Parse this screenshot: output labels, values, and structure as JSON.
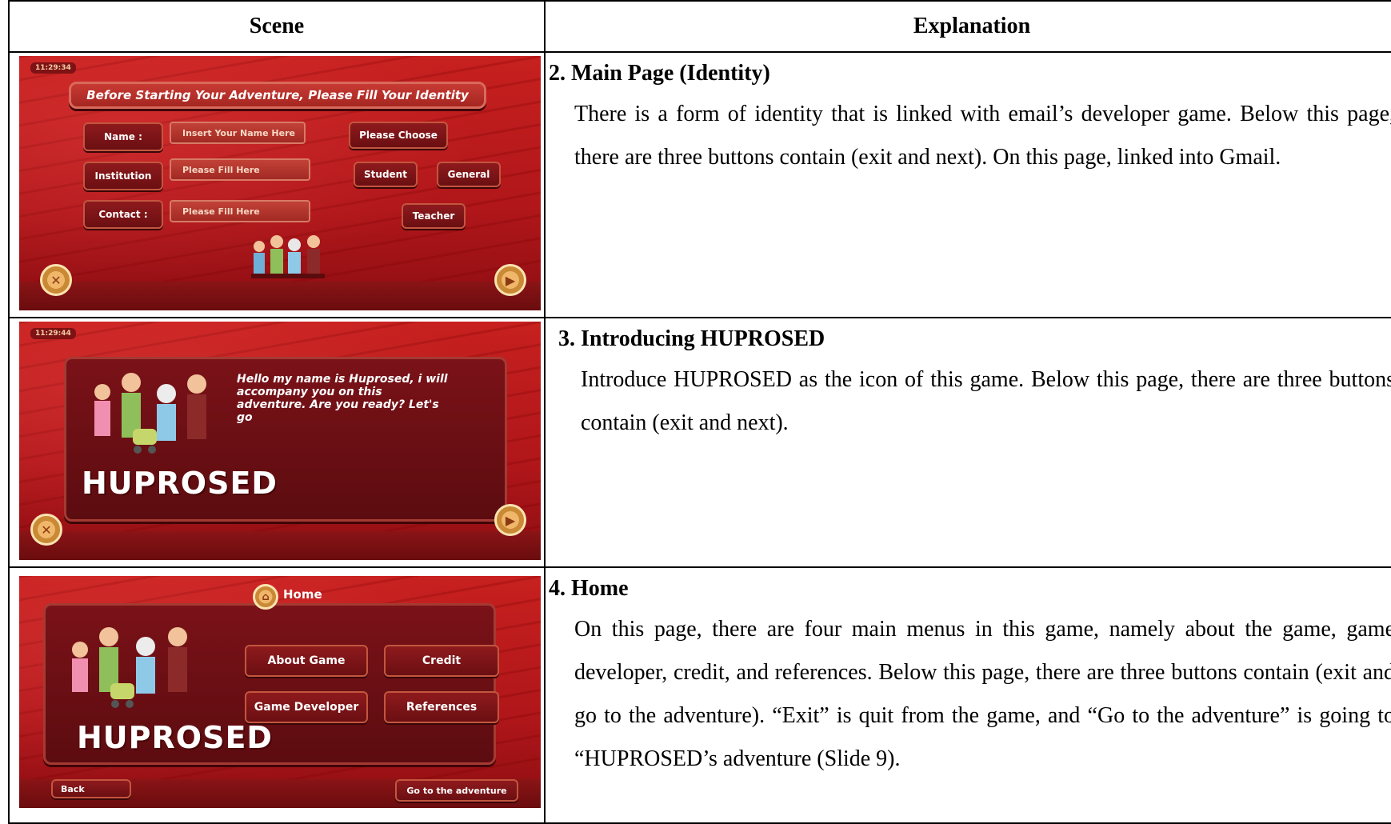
{
  "table": {
    "headers": {
      "scene": "Scene",
      "explanation": "Explanation"
    },
    "rows": [
      {
        "title": "2. Main Page (Identity)",
        "body": "There is a form of identity that is linked with email’s developer game. Below this page, there are three buttons contain (exit and next). On this page, linked into Gmail.",
        "screen": {
          "clock": "11:29:34",
          "heading": "Before Starting Your Adventure, Please Fill Your Identity",
          "name_label": "Name :",
          "name_placeholder": "Insert Your Name Here",
          "institution_label": "Institution",
          "institution_placeholder": "Please Fill Here",
          "contact_label": "Contact :",
          "contact_placeholder": "Please Fill Here",
          "choose_label": "Please Choose",
          "student_label": "Student",
          "general_label": "General",
          "teacher_label": "Teacher",
          "exit_icon": "close-icon",
          "next_icon": "play-icon"
        }
      },
      {
        "title": "3. Introducing HUPROSED",
        "body": "Introduce HUPROSED as the icon of this game. Below this page, there are three buttons contain (exit and next).",
        "screen": {
          "clock": "11:29:44",
          "speech": "Hello my name is Huprosed, i will accompany you on this adventure. Are you ready? Let's go",
          "logo": "HUPROSED",
          "exit_icon": "close-icon",
          "next_icon": "play-icon"
        }
      },
      {
        "title": "4. Home",
        "body": "On this page, there are four main menus in this game, namely about the game, game developer, credit, and references. Below this page, there are three buttons contain (exit and go to the adventure). “Exit” is quit from the game, and “Go to the adventure” is going to “HUPROSED’s adventure (Slide 9).",
        "screen": {
          "home_label": "Home",
          "about_label": "About Game",
          "credit_label": "Credit",
          "developer_label": "Game Developer",
          "references_label": "References",
          "logo": "HUPROSED",
          "back_label": "Back",
          "adventure_label": "Go to the adventure",
          "home_icon": "home-icon"
        }
      }
    ]
  },
  "colors": {
    "game_red": "#c7201f",
    "plank_dark": "#6b0f12",
    "accent_gold": "#f0b66a"
  }
}
